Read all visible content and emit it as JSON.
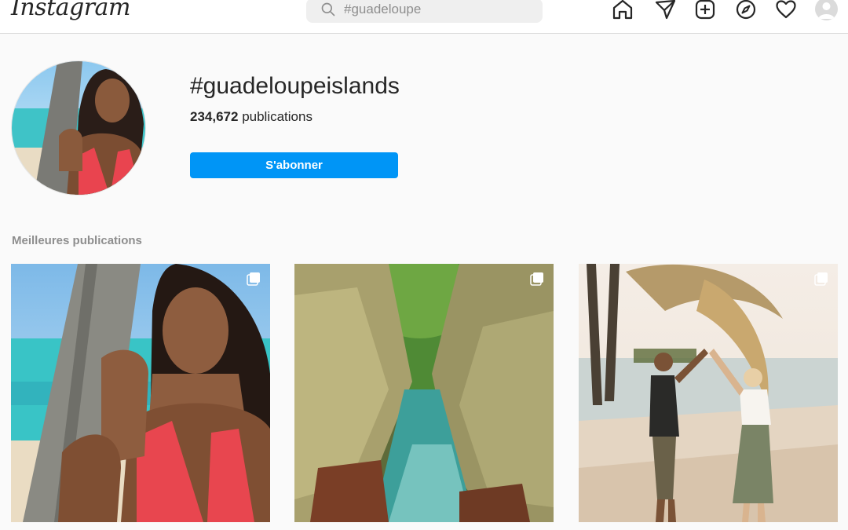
{
  "app": {
    "logo": "Instagram"
  },
  "search": {
    "placeholder": "#guadeloupe",
    "value": ""
  },
  "nav": {
    "icons": [
      "home-icon",
      "direct-icon",
      "new-post-icon",
      "explore-icon",
      "activity-icon",
      "profile-avatar"
    ]
  },
  "hashtag": {
    "title": "#guadeloupeislands",
    "count": "234,672",
    "count_label": "publications",
    "follow_label": "S'abonner"
  },
  "top_posts": {
    "label": "Meilleures publications",
    "items": [
      {
        "subject": "woman-by-palm-tree",
        "multiple": true
      },
      {
        "subject": "canyon-river",
        "multiple": true
      },
      {
        "subject": "couple-dancing-on-beach",
        "multiple": true
      }
    ]
  },
  "colors": {
    "accent": "#0095f6",
    "background": "#fafafa",
    "border": "#dbdbdb"
  }
}
